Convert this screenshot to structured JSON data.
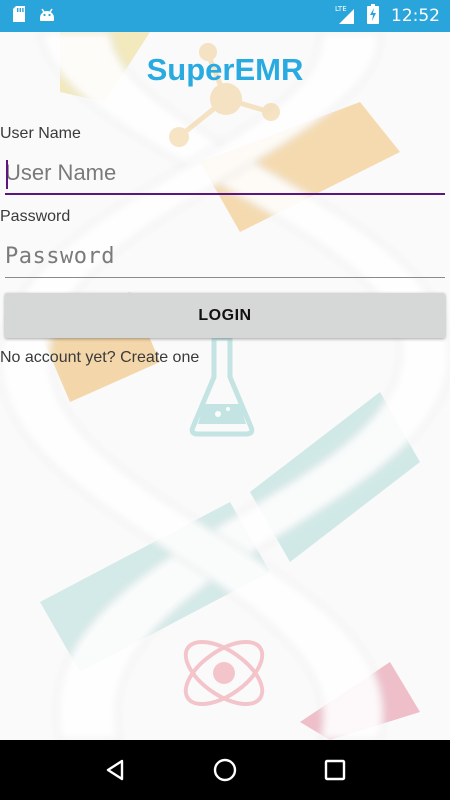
{
  "status_bar": {
    "time": "12:52",
    "network": "LTE",
    "icons": [
      "sd-card-icon",
      "android-icon",
      "signal-icon",
      "battery-charging-icon"
    ],
    "background_color": "#2aa5dc"
  },
  "app": {
    "title": "SuperEMR",
    "title_color": "#29abe2"
  },
  "form": {
    "username_label": "User Name",
    "username_placeholder": "User Name",
    "username_value": "",
    "password_label": "Password",
    "password_placeholder": "Password",
    "password_value": "",
    "login_label": "LOGIN",
    "create_account_text": "No account yet? Create one",
    "focus_color": "#5b177f"
  },
  "nav_bar": {
    "buttons": [
      "back-icon",
      "home-icon",
      "recents-icon"
    ]
  }
}
